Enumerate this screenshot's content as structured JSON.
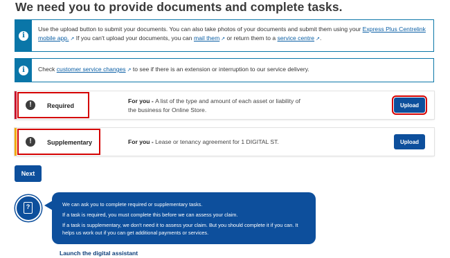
{
  "page": {
    "title": "We need you to provide documents and complete tasks."
  },
  "info_upload": {
    "text_1": "Use the upload button to submit your documents. You can also take photos of your documents and submit them using your ",
    "link_app": "Express Plus Centrelink mobile app.",
    "text_2": " If you can't upload your documents, you can ",
    "link_mail": "mail them",
    "text_3": " or return them to a ",
    "link_centre": "service centre",
    "text_4": "."
  },
  "info_changes": {
    "text_1": "Check ",
    "link": "customer service changes",
    "text_2": " to see if there is an extension or interruption to our service delivery."
  },
  "tasks": [
    {
      "label": "Required",
      "for_you": "For you - ",
      "description": "A list of the type and amount of each asset or liability of the business for Online Store.",
      "button": "Upload",
      "edge_color": "#c8102e"
    },
    {
      "label": "Supplementary",
      "for_you": "For you - ",
      "description": "Lease or tenancy agreement for 1 DIGITAL ST.",
      "button": "Upload",
      "edge_color": "#f2a900"
    }
  ],
  "next_button": "Next",
  "assistant": {
    "lines": [
      "We can ask you to complete required or supplementary tasks.",
      "If a task is required, you must complete this before we can assess your claim.",
      "If a task is supplementary, we don't need it to assess your claim. But you should complete it if you can. It helps us work out if you can get additional payments or services."
    ],
    "launch_link": "Launch the digital assistant"
  },
  "icons": {
    "info": "info-icon",
    "alert": "alert-icon",
    "external": "external-link-icon",
    "assistant": "document-icon"
  },
  "colors": {
    "primary": "#0d4f9c",
    "info_border": "#0a76a8",
    "highlight": "#d40000"
  }
}
